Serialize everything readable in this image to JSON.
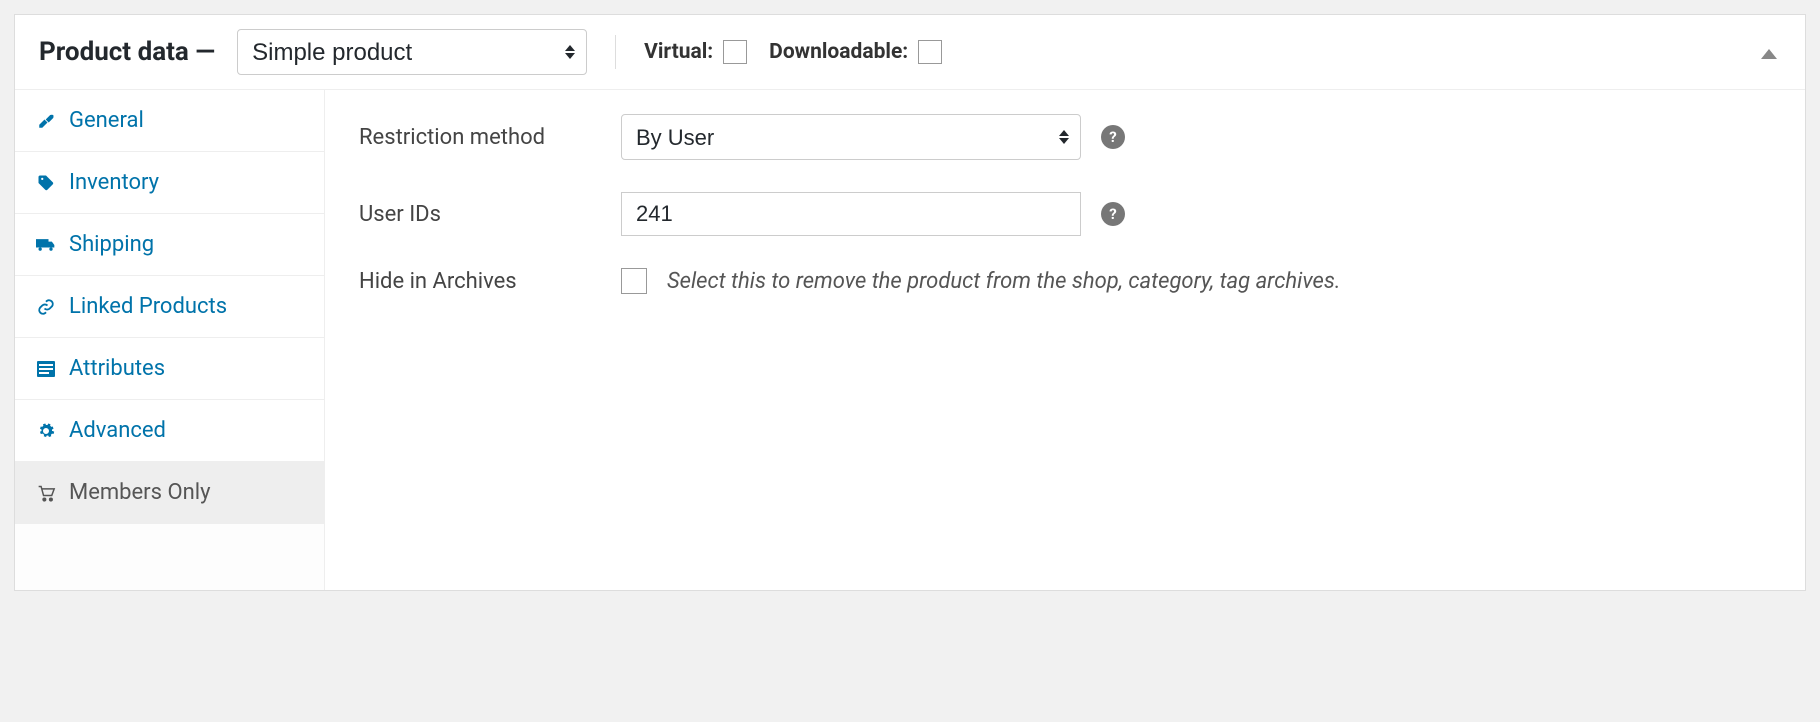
{
  "header": {
    "title": "Product data —",
    "product_type": "Simple product",
    "virtual_label": "Virtual:",
    "downloadable_label": "Downloadable:"
  },
  "tabs": [
    {
      "key": "general",
      "label": "General",
      "icon": "wrench",
      "active": false
    },
    {
      "key": "inventory",
      "label": "Inventory",
      "icon": "tag",
      "active": false
    },
    {
      "key": "shipping",
      "label": "Shipping",
      "icon": "truck",
      "active": false
    },
    {
      "key": "linked",
      "label": "Linked Products",
      "icon": "link",
      "active": false
    },
    {
      "key": "attributes",
      "label": "Attributes",
      "icon": "list",
      "active": false
    },
    {
      "key": "advanced",
      "label": "Advanced",
      "icon": "gear",
      "active": false
    },
    {
      "key": "members",
      "label": "Members Only",
      "icon": "cart",
      "active": true
    }
  ],
  "form": {
    "restriction_method": {
      "label": "Restriction method",
      "value": "By User"
    },
    "user_ids": {
      "label": "User IDs",
      "value": "241"
    },
    "hide_in_archives": {
      "label": "Hide in Archives",
      "hint": "Select this to remove the product from the shop, category, tag archives."
    }
  }
}
